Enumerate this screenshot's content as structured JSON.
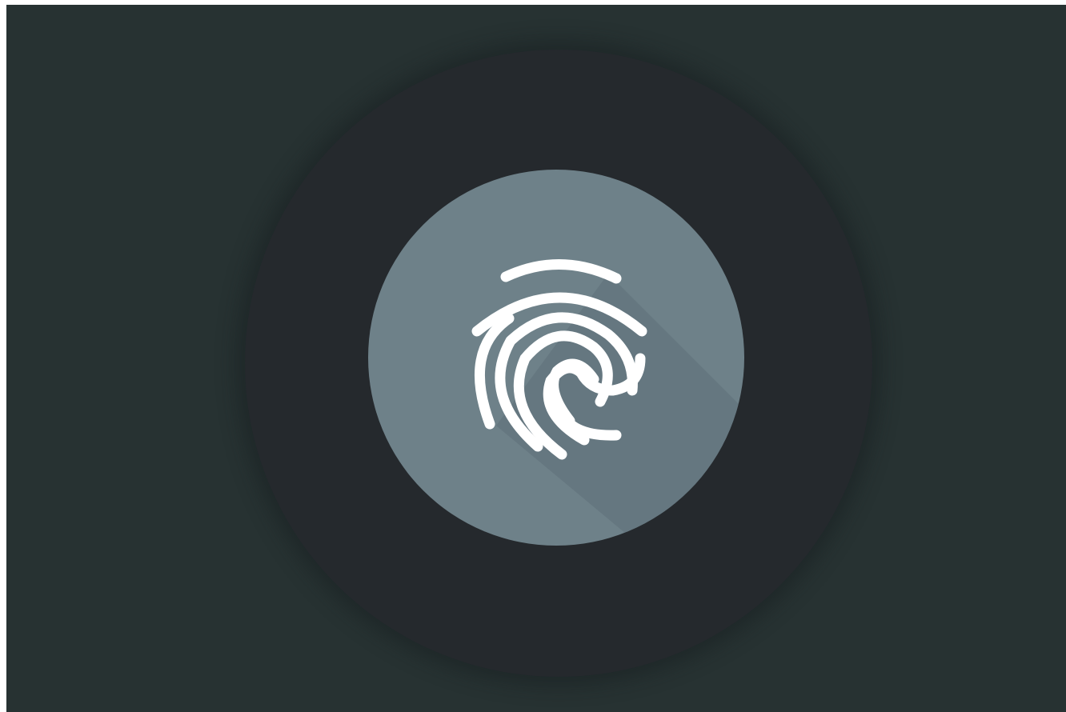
{
  "screen": {
    "background_color": "#273232",
    "outer_ring_color": "#25292d",
    "sensor_color": "#6e8189",
    "sensor_shadow_color": "#5f7079",
    "icon_color": "#ffffff"
  },
  "fingerprint_button": {
    "icon": "fingerprint-icon"
  }
}
